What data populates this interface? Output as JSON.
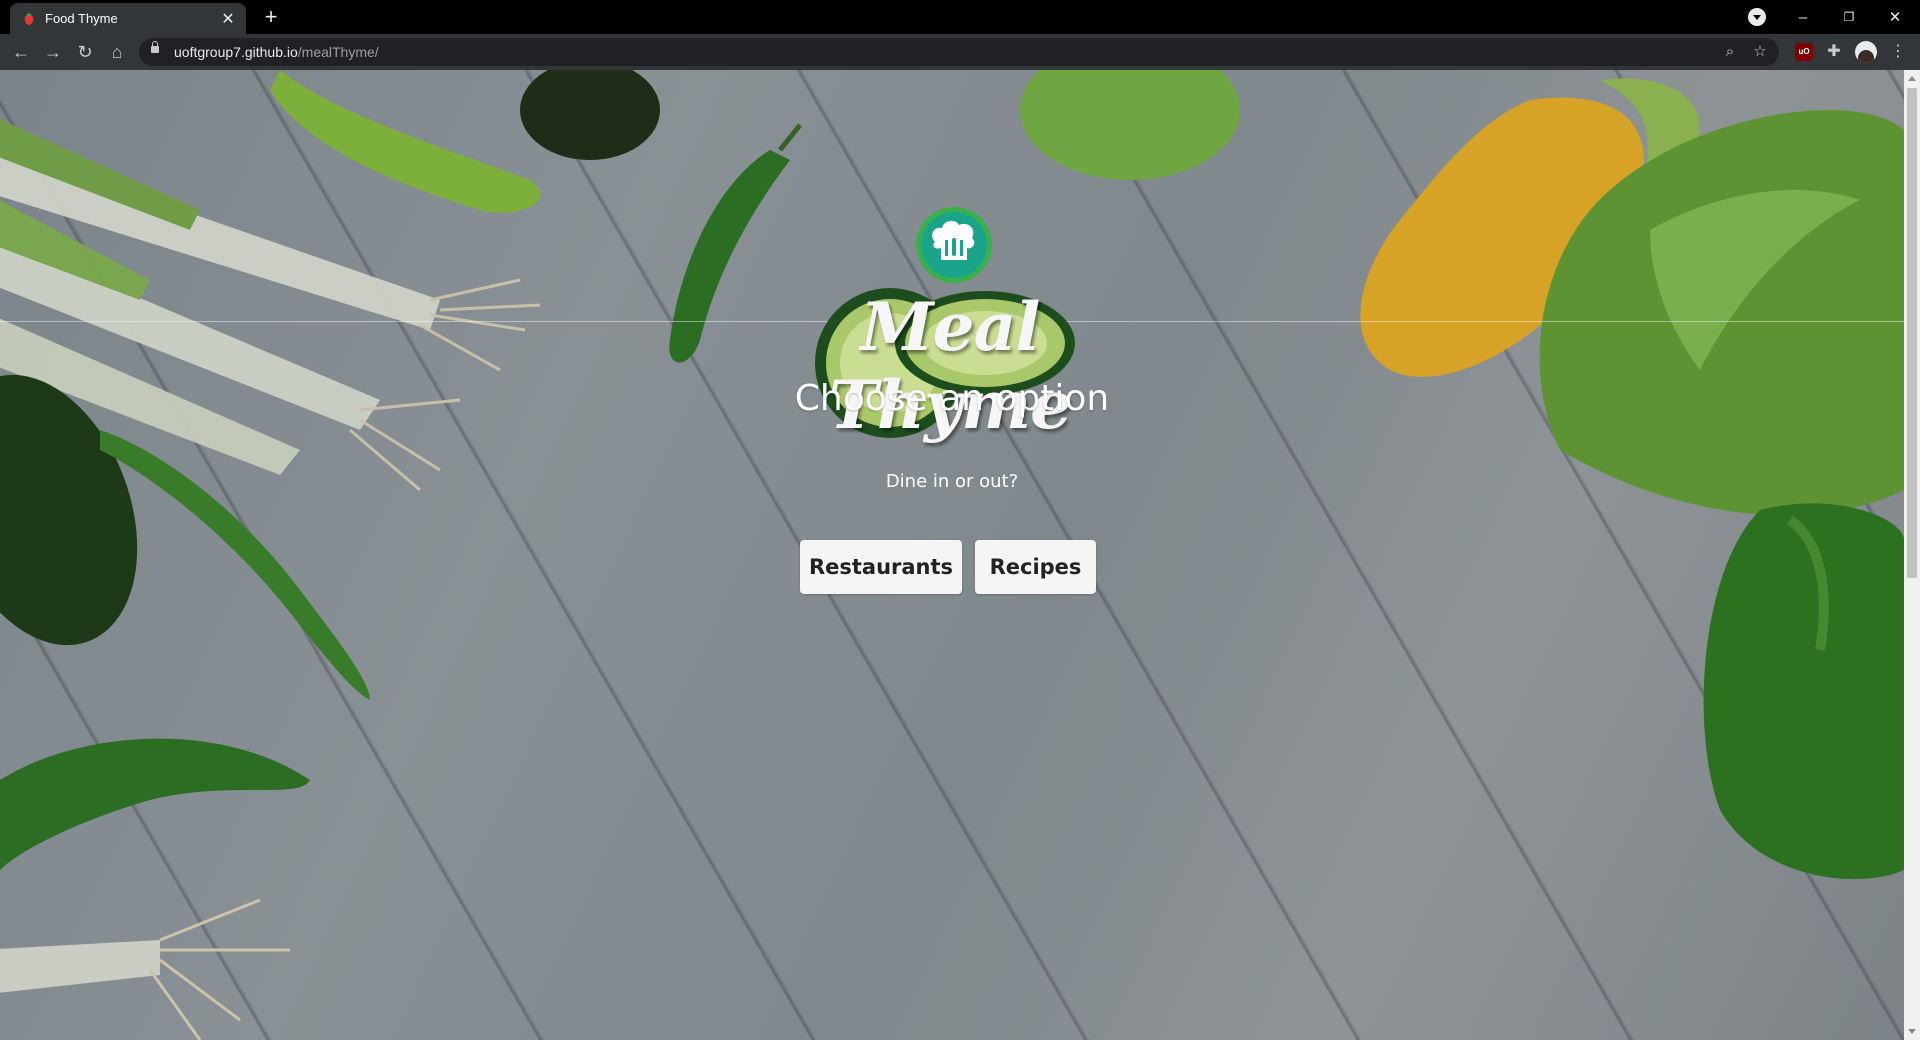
{
  "browser": {
    "tab_title": "Food Thyme",
    "url_host": "uoftgroup7.github.io",
    "url_path": "/mealThyme/",
    "window_controls": {
      "minimize": "–",
      "restore": "❐",
      "close": "✕"
    },
    "icons": [
      "back-icon",
      "forward-icon",
      "reload-icon",
      "home-icon",
      "lock-icon",
      "zoom-icon",
      "star-icon",
      "ublock-icon",
      "extensions-icon",
      "profile-avatar",
      "menu-icon"
    ]
  },
  "page": {
    "logo_text": "Meal Thyme",
    "heading": "Choose an option",
    "subheading": "Dine in or out?",
    "buttons": {
      "restaurants": "Restaurants",
      "recipes": "Recipes"
    }
  },
  "colors": {
    "logo_badge": "#1aa58a",
    "logo_ring": "#3bb04a",
    "button_bg": "#f5f5f5"
  }
}
